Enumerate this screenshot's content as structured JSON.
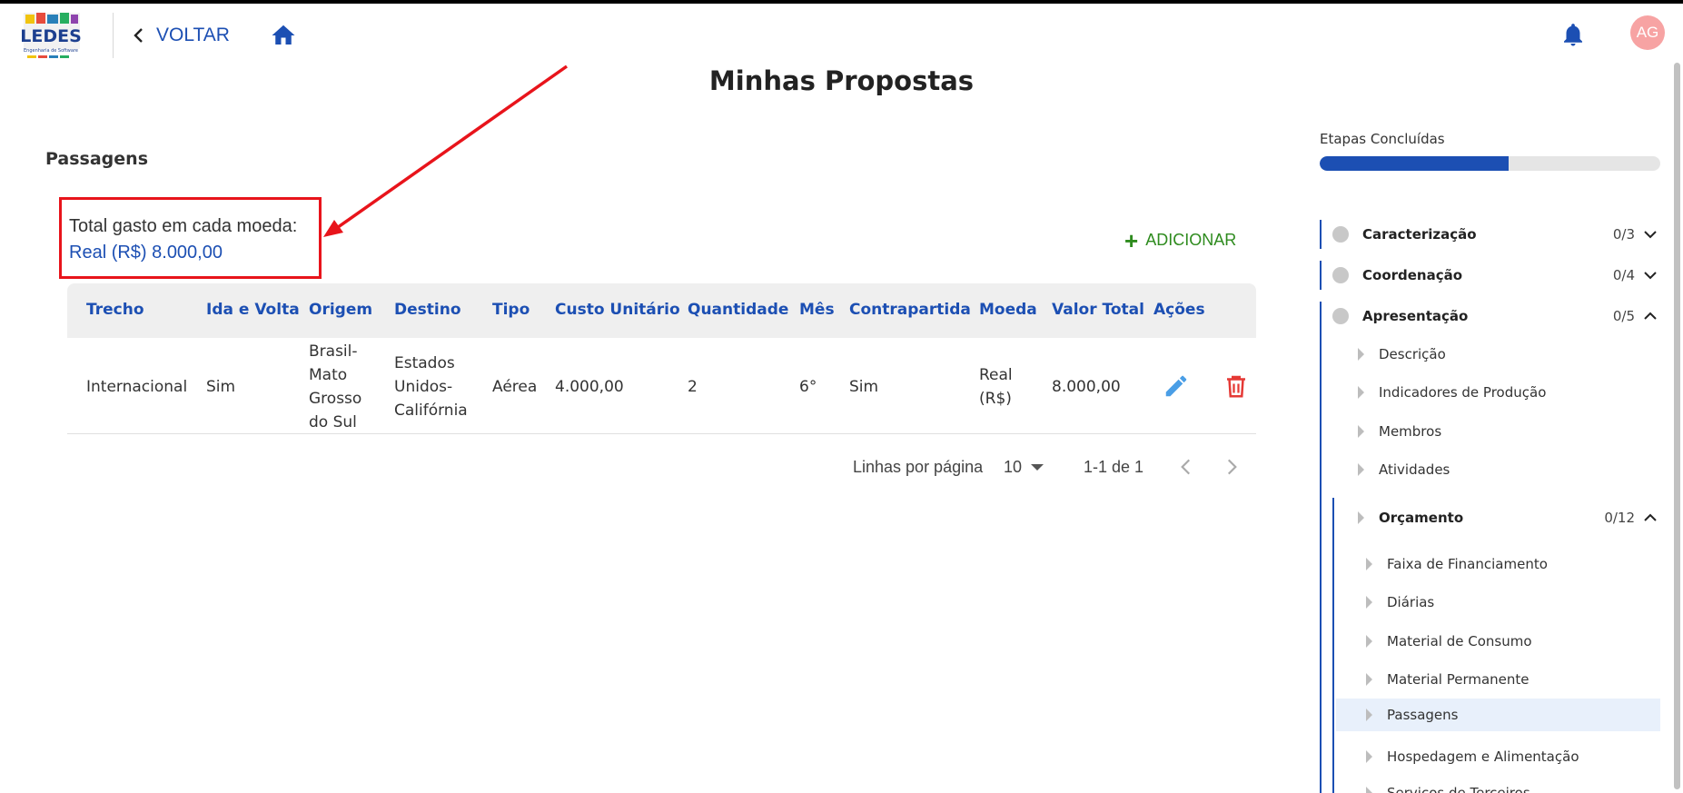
{
  "header": {
    "logo_text": "LEDES",
    "logo_subtitle": "Engenharia de Software",
    "back_label": "VOLTAR",
    "avatar_initials": "AG"
  },
  "page_title": "Minhas Propostas",
  "section_title": "Passagens",
  "totals": {
    "label": "Total gasto em cada moeda:",
    "value": "Real (R$) 8.000,00"
  },
  "add_label": "ADICIONAR",
  "table": {
    "headers": [
      "Trecho",
      "Ida e Volta",
      "Origem",
      "Destino",
      "Tipo",
      "Custo Unitário",
      "Quantidade",
      "Mês",
      "Contrapartida",
      "Moeda",
      "Valor Total",
      "Ações"
    ],
    "rows": [
      {
        "trecho": "Internacional",
        "ida_volta": "Sim",
        "origem": [
          "Brasil-",
          "Mato",
          "Grosso",
          "do Sul"
        ],
        "destino": [
          "Estados",
          "Unidos-",
          "Califórnia"
        ],
        "tipo": "Aérea",
        "custo_unitario": "4.000,00",
        "quantidade": "2",
        "mes": "6°",
        "contrapartida": "Sim",
        "moeda": [
          "Real",
          "(R$)"
        ],
        "valor_total": "8.000,00"
      }
    ]
  },
  "pagination": {
    "rows_per_page_label": "Linhas por página",
    "rows_per_page": "10",
    "range": "1-1 de 1"
  },
  "sidebar": {
    "etapas_label": "Etapas Concluídas",
    "progress": 0.555,
    "groups": [
      {
        "name": "Caracterização",
        "count": "0/3",
        "expanded": false
      },
      {
        "name": "Coordenação",
        "count": "0/4",
        "expanded": false
      },
      {
        "name": "Apresentação",
        "count": "0/5",
        "expanded": true
      }
    ],
    "apresentacao_items": [
      "Descrição",
      "Indicadores de Produção",
      "Membros",
      "Atividades"
    ],
    "orcamento": {
      "name": "Orçamento",
      "count": "0/12"
    },
    "orcamento_items": [
      "Faixa de Financiamento",
      "Diárias",
      "Material de Consumo",
      "Material Permanente",
      "Passagens",
      "Hospedagem e Alimentação",
      "Serviços de Terceiros"
    ],
    "active_item": "Passagens"
  },
  "colors": {
    "primary": "#1c4fb3",
    "accent_green": "#2e8b1e",
    "highlight_red": "#e8141b",
    "edit_blue": "#4a9ee6",
    "delete_red": "#e53935"
  }
}
